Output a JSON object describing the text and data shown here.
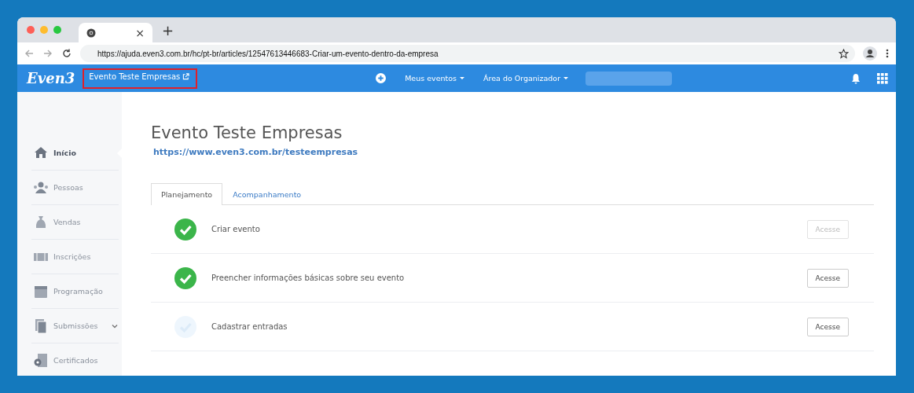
{
  "browser": {
    "tab_close": "×",
    "new_tab": "+",
    "url": "https://ajuda.even3.com.br/hc/pt-br/articles/12547613446683-Criar-um-evento-dentro-da-empresa"
  },
  "header": {
    "logo": "Even3",
    "event_link": "Evento Teste Empresas",
    "nav": [
      {
        "label": "Meus eventos"
      },
      {
        "label": "Área do Organizador"
      }
    ]
  },
  "sidebar": {
    "items": [
      {
        "label": "Início",
        "selected": true,
        "expandable": false
      },
      {
        "label": "Pessoas",
        "selected": false,
        "expandable": false
      },
      {
        "label": "Vendas",
        "selected": false,
        "expandable": false
      },
      {
        "label": "Inscrições",
        "selected": false,
        "expandable": false
      },
      {
        "label": "Programação",
        "selected": false,
        "expandable": false
      },
      {
        "label": "Submissões",
        "selected": false,
        "expandable": true
      },
      {
        "label": "Certificados",
        "selected": false,
        "expandable": false
      }
    ]
  },
  "page": {
    "title": "Evento Teste Empresas",
    "url": "https://www.even3.com.br/testeempresas",
    "tabs": [
      {
        "label": "Planejamento",
        "selected": true
      },
      {
        "label": "Acompanhamento",
        "selected": false
      }
    ],
    "steps": [
      {
        "label": "Criar evento",
        "done": true,
        "button": "Acesse",
        "button_disabled": true
      },
      {
        "label": "Preencher informações básicas sobre seu evento",
        "done": true,
        "button": "Acesse",
        "button_disabled": false
      },
      {
        "label": "Cadastrar entradas",
        "done": false,
        "button": "Acesse",
        "button_disabled": false
      }
    ]
  }
}
